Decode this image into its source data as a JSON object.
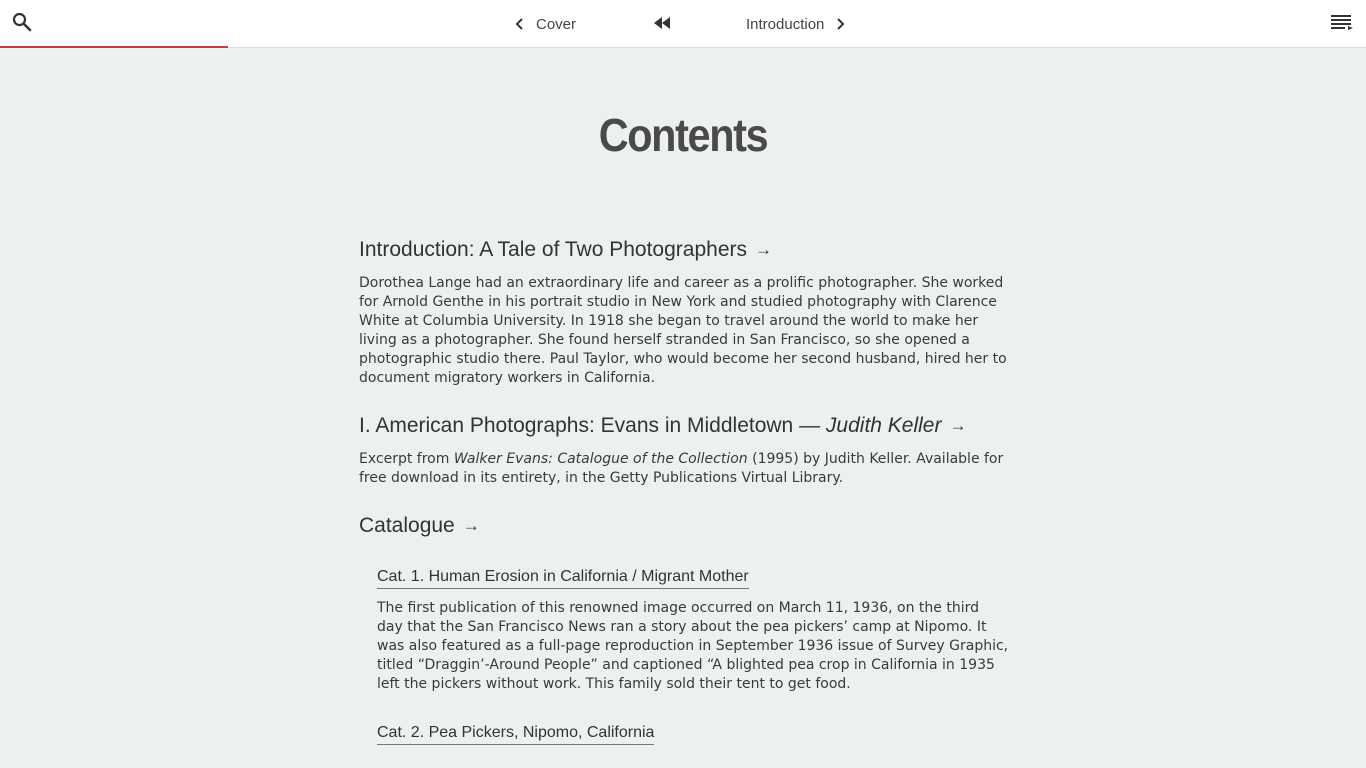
{
  "nav": {
    "prev_label": "Cover",
    "next_label": "Introduction",
    "progress_fraction": 0.167,
    "accent_color": "#c2403a",
    "icons": [
      "search-icon",
      "chevron-left-icon",
      "rewind-icon",
      "chevron-right-icon",
      "menu-icon"
    ]
  },
  "page": {
    "title": "Contents"
  },
  "sections": {
    "intro": {
      "heading": "Introduction: A Tale of Two Photographers",
      "arrow": "→",
      "description": "Dorothea Lange had an extraordinary life and career as a prolific photographer. She worked for Arnold Genthe in his portrait studio in New York and studied photography with Clarence White at Columbia University. In 1918 she began to travel around the world to make her living as a photographer. She found herself stranded in San Francisco, so she opened a photographic studio there. Paul Taylor, who would become her second husband, hired her to document migratory workers in California."
    },
    "evans": {
      "heading_main": "I. American Photographs: Evans in Middletown —",
      "heading_author": "Judith Keller",
      "arrow": "→",
      "desc_prefix": "Excerpt from",
      "desc_title": "Walker Evans: Catalogue of the Collection",
      "desc_suffix": "(1995) by Judith Keller. Available for free download in its entirety, in the Getty Publications Virtual Library."
    },
    "catalogue": {
      "heading": "Catalogue",
      "arrow": "→",
      "items": [
        {
          "title": "Cat. 1. Human Erosion in California / Migrant Mother",
          "description": "The first publication of this renowned image occurred on March 11, 1936, on the third day that the San Francisco News ran a story about the pea pickers’ camp at Nipomo. It was also featured as a full-page reproduction in September 1936 issue of Survey Graphic, titled “Draggin’-Around People” and captioned “A blighted pea crop in California in 1935 left the pickers without work. This family sold their tent to get food."
        },
        {
          "title": "Cat. 2. Pea Pickers, Nipomo, California"
        }
      ]
    }
  }
}
